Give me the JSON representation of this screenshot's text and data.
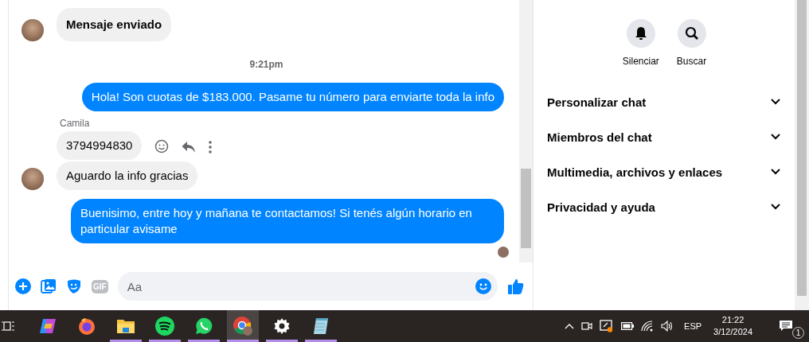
{
  "chat": {
    "messages": [
      {
        "kind": "incoming",
        "text": "Mensaje enviado",
        "avatar": true,
        "bold": true,
        "actions": false
      },
      {
        "kind": "timestamp",
        "text": "9:21pm"
      },
      {
        "kind": "outgoing",
        "text": "Hola! Son cuotas de $183.000. Pasame tu número para enviarte toda la info"
      },
      {
        "kind": "incoming",
        "sender": "Camila",
        "text": "3794994830",
        "avatar": false,
        "bold": false,
        "actions": true
      },
      {
        "kind": "incoming",
        "text": "Aguardo la info gracias",
        "avatar": true,
        "bold": false,
        "actions": false
      },
      {
        "kind": "outgoing",
        "text": "Buenisimo, entre hoy y mañana te contactamos! Si tenés algún horario en particular avisame"
      }
    ],
    "seen": true
  },
  "composer": {
    "placeholder": "Aa",
    "tools": [
      {
        "kind": "plus"
      },
      {
        "kind": "gallery"
      },
      {
        "kind": "sticker"
      },
      {
        "kind": "gif",
        "label": "GIF"
      }
    ]
  },
  "details": {
    "actions": [
      {
        "kind": "bell",
        "label": "Silenciar"
      },
      {
        "kind": "search",
        "label": "Buscar"
      }
    ],
    "sections": [
      {
        "label": "Personalizar chat",
        "expanded": false
      },
      {
        "label": "Miembros del chat",
        "expanded": false
      },
      {
        "label": "Multimedia, archivos y enlaces",
        "expanded": false
      },
      {
        "label": "Privacidad y ayuda",
        "expanded": false
      }
    ]
  },
  "taskbar": {
    "apps": [
      {
        "kind": "copilot",
        "open": false,
        "selected": false
      },
      {
        "kind": "firefox",
        "open": false,
        "selected": false
      },
      {
        "kind": "explorer",
        "open": true,
        "selected": false
      },
      {
        "kind": "spotify",
        "open": true,
        "selected": false
      },
      {
        "kind": "whatsapp",
        "open": true,
        "selected": false
      },
      {
        "kind": "chrome",
        "open": true,
        "selected": true
      },
      {
        "kind": "settings",
        "open": true,
        "selected": false
      },
      {
        "kind": "notepad",
        "open": true,
        "selected": false
      }
    ],
    "language": "ESP",
    "time": "21:22",
    "date": "3/12/2024",
    "notifications": "1"
  }
}
